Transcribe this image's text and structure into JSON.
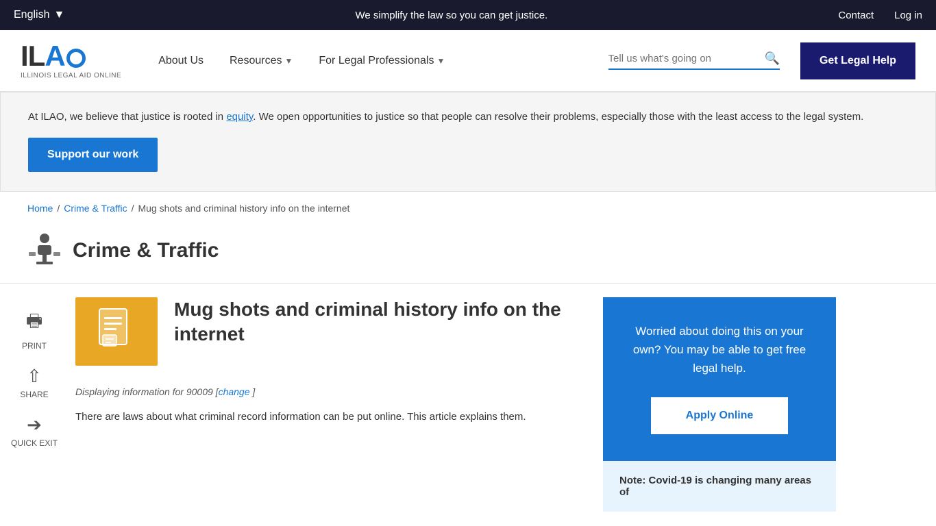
{
  "topbar": {
    "language": "English",
    "language_chevron": "▼",
    "tagline": "We simplify the law so you can get justice.",
    "contact": "Contact",
    "login": "Log in"
  },
  "logo": {
    "text": "ILAO",
    "subtitle": "ILLINOIS LEGAL AID ONLINE"
  },
  "nav": {
    "about": "About Us",
    "resources": "Resources",
    "resources_chevron": "▼",
    "for_legal": "For Legal Professionals",
    "for_legal_chevron": "▼",
    "search_placeholder": "Tell us what's going on",
    "get_legal_help": "Get Legal Help"
  },
  "banner": {
    "text_before": "At ILAO, we believe that justice is rooted in ",
    "equity_link": "equity",
    "text_after": ". We open opportunities to justice so that people can resolve their problems, especially those with the least access to the legal system.",
    "support_button": "Support our work"
  },
  "breadcrumb": {
    "home": "Home",
    "crime_traffic": "Crime & Traffic",
    "current": "Mug shots and criminal history info on the internet"
  },
  "category": {
    "title": "Crime & Traffic"
  },
  "sidebar": {
    "print": "PRINT",
    "share": "SHARE",
    "quick_exit": "QUICK EXIT"
  },
  "article": {
    "title": "Mug shots and criminal history info on the internet",
    "meta_prefix": "Displaying information for 90009 [",
    "change_link": "change",
    "meta_suffix": " ]",
    "intro": "There are laws about what criminal record information can be put online. This article explains them."
  },
  "legal_help_card": {
    "text": "Worried about doing this on your own? You may be able to get free legal help.",
    "apply_button": "Apply Online"
  },
  "covid_note": {
    "text": "Note: Covid-19 is changing many areas of"
  }
}
